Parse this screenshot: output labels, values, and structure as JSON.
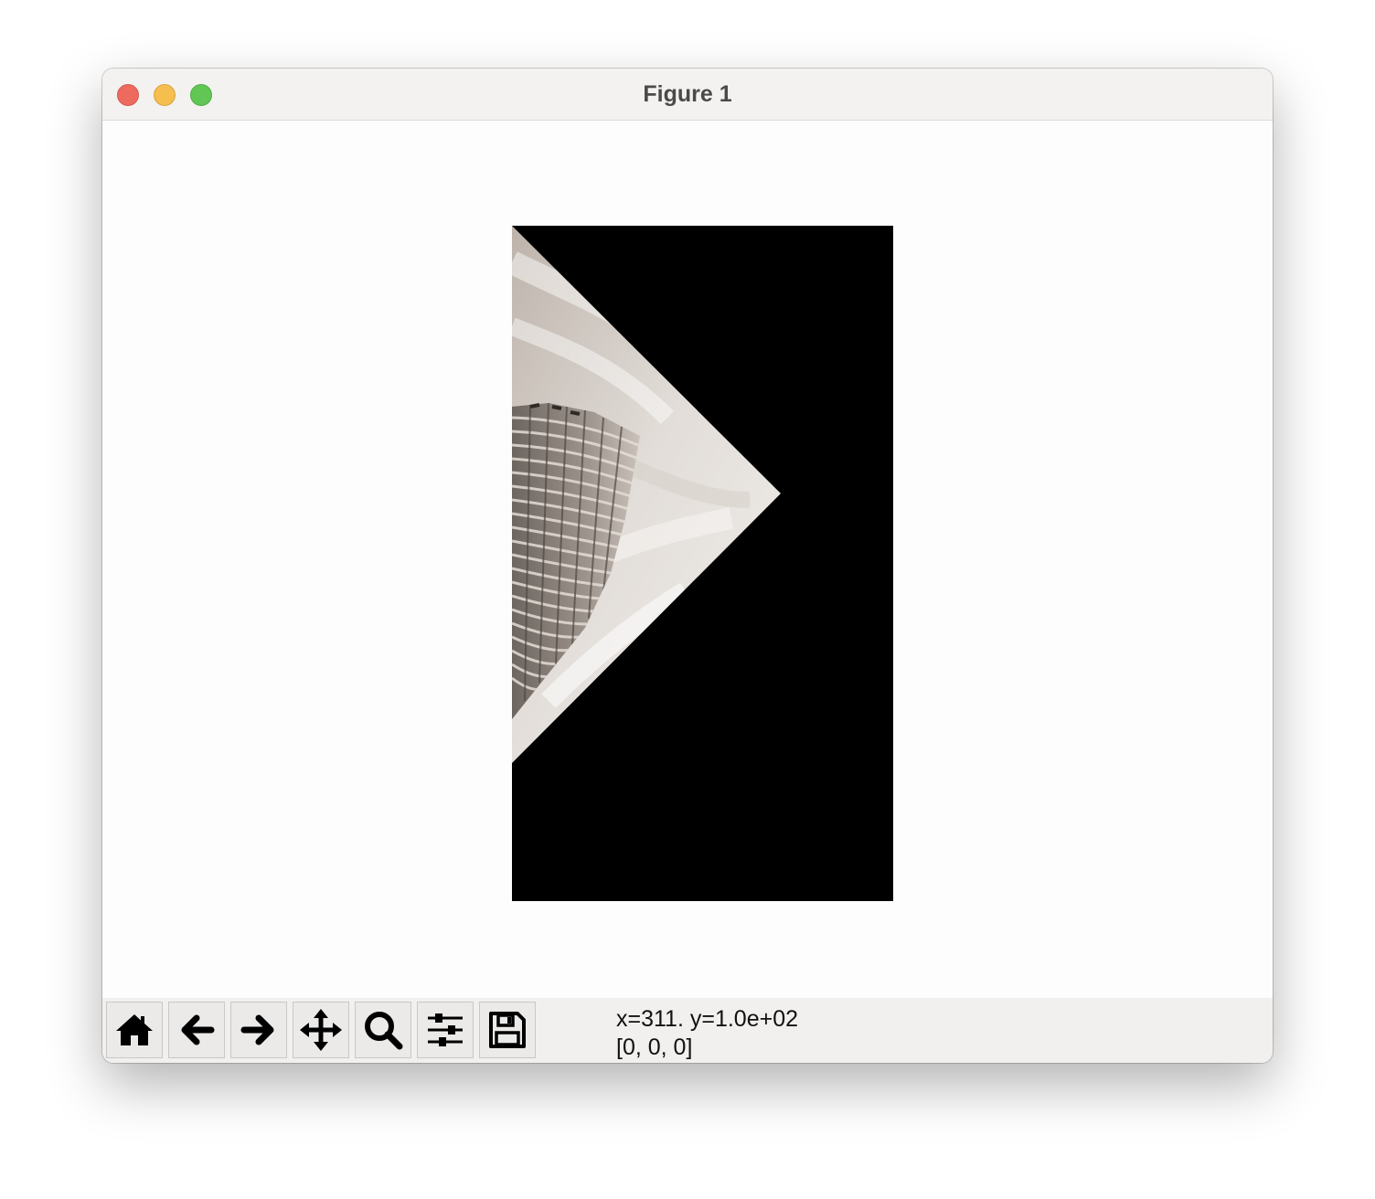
{
  "window": {
    "title": "Figure 1"
  },
  "toolbar": {
    "buttons": [
      {
        "name": "home",
        "icon": "home-icon"
      },
      {
        "name": "back",
        "icon": "arrow-left-icon"
      },
      {
        "name": "forward",
        "icon": "arrow-right-icon"
      },
      {
        "name": "pan",
        "icon": "move-arrows-icon"
      },
      {
        "name": "zoom",
        "icon": "magnifier-icon"
      },
      {
        "name": "configure-subplots",
        "icon": "sliders-icon"
      },
      {
        "name": "save",
        "icon": "floppy-disk-icon"
      }
    ]
  },
  "status": {
    "coordinates": "x=311. y=1.0e+02",
    "pixel_value": "[0, 0, 0]"
  },
  "colors": {
    "titlebar": "#f4f2f0",
    "canvas": "#fdfdfd",
    "toolbar": "#f1f0ef",
    "close": "#ee6a5f",
    "minimize": "#f5be4f",
    "maximize": "#62c655",
    "image_background": "#000000"
  }
}
